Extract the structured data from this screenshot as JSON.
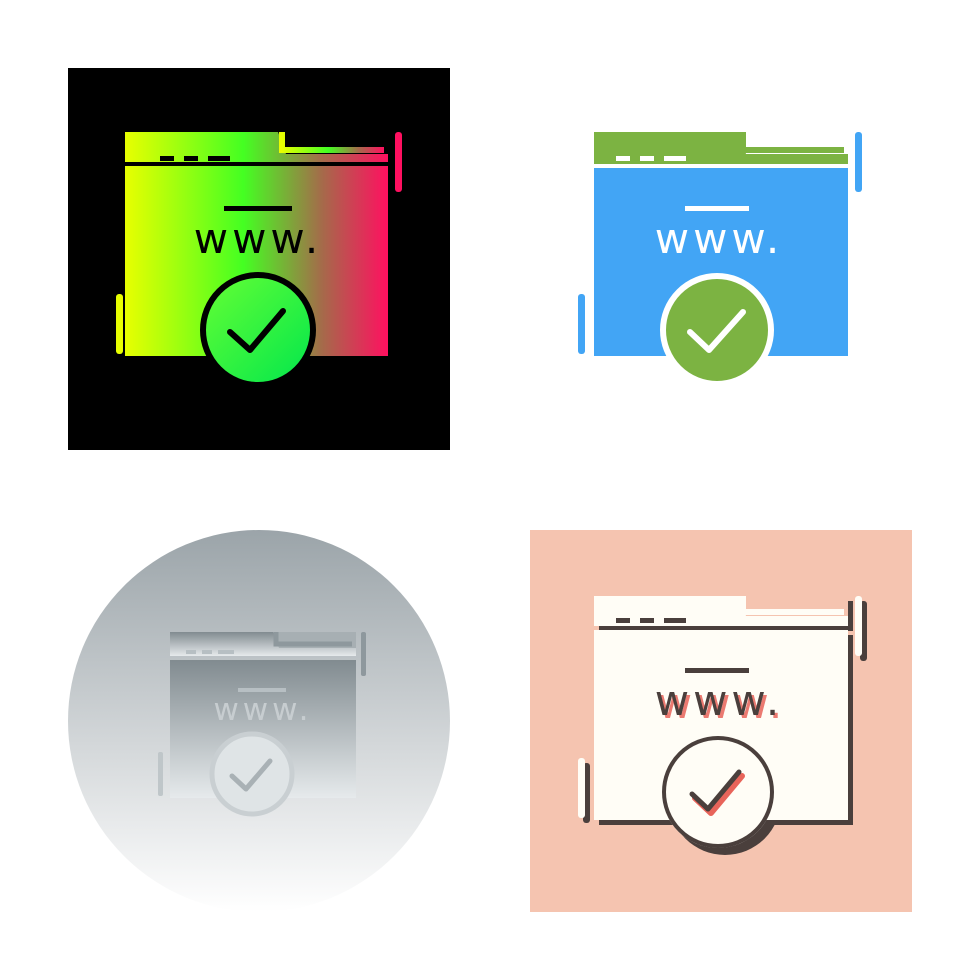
{
  "variants": [
    {
      "id": "gradient",
      "background": "black-square",
      "bg_color": "#000000",
      "gradient": [
        "#e6ff00",
        "#00ff33",
        "#ff1060"
      ],
      "label": "www."
    },
    {
      "id": "flat-color",
      "background": "none",
      "top_color": "#7cb342",
      "body_color": "#42a5f5",
      "badge_color": "#7cb342",
      "label": "www."
    },
    {
      "id": "gray-gradient",
      "background": "circle",
      "bg_colors": [
        "#9ea7ac",
        "#ffffff"
      ],
      "label": "www."
    },
    {
      "id": "peach-shadow",
      "background": "peach-square",
      "bg_color": "#f5c4b0",
      "fill_color": "#fffdf6",
      "shadow_color": "#4a3f3c",
      "accent_color": "#e8645a",
      "label": "www."
    }
  ],
  "icon_name": "verified-website-icon"
}
